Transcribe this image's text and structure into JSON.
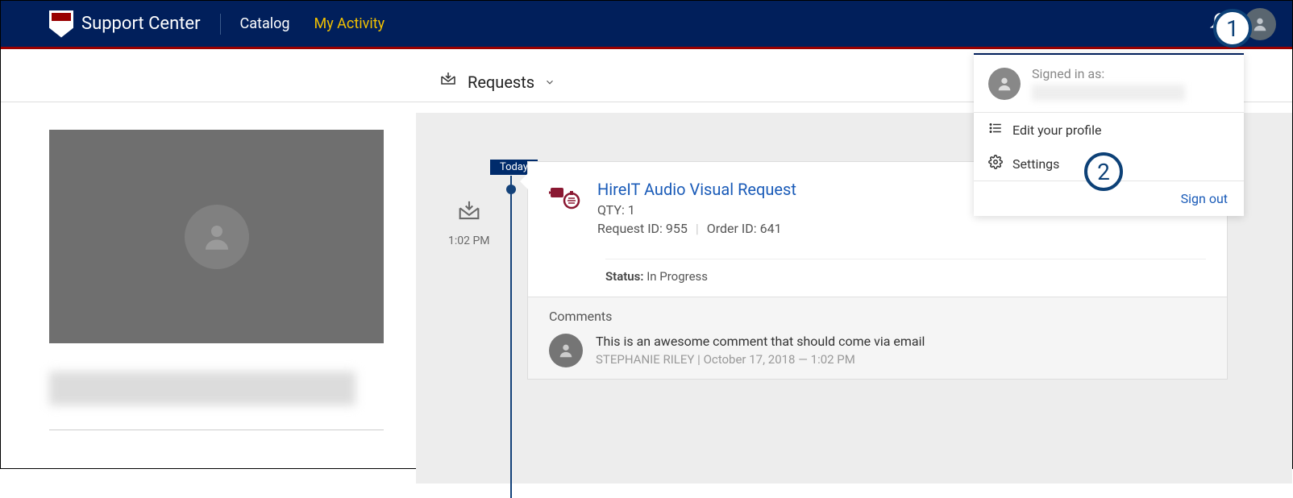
{
  "header": {
    "brand_title": "Support Center",
    "nav": {
      "catalog": "Catalog",
      "my_activity": "My Activity"
    }
  },
  "dropdown": {
    "signed_in_label": "Signed in as:",
    "edit_profile": "Edit your profile",
    "settings": "Settings",
    "sign_out": "Sign out"
  },
  "main": {
    "requests_label": "Requests",
    "today_label": "Today",
    "timeline_time": "1:02 PM"
  },
  "card": {
    "title": "HireIT Audio Visual Request",
    "qty_label": "QTY: 1",
    "request_id_label": "Request ID: 955",
    "order_id_label": "Order ID: 641",
    "status_label": "Status:",
    "status_value": "In Progress"
  },
  "comments": {
    "heading": "Comments",
    "text": "This is an awesome comment that should come via email",
    "author": "STEPHANIE RILEY",
    "date": "October 17, 2018 — 1:02 PM"
  },
  "callouts": {
    "one": "1",
    "two": "2"
  }
}
